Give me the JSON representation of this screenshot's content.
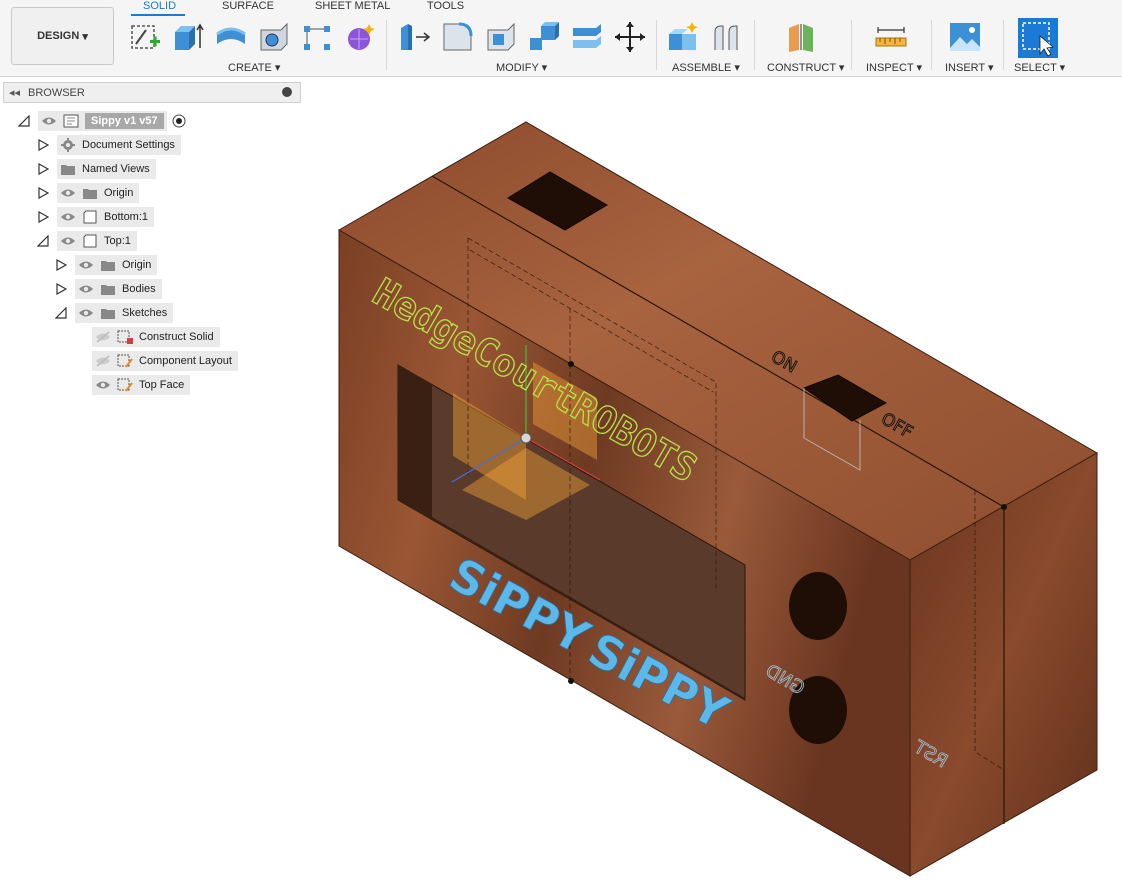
{
  "design_menu": {
    "label": "DESIGN"
  },
  "tabs": [
    {
      "label": "SOLID"
    },
    {
      "label": "SURFACE"
    },
    {
      "label": "SHEET METAL"
    },
    {
      "label": "TOOLS"
    }
  ],
  "groups": {
    "create": "CREATE",
    "modify": "MODIFY",
    "assemble": "ASSEMBLE",
    "construct": "CONSTRUCT",
    "inspect": "INSPECT",
    "insert": "INSERT",
    "select": "SELECT"
  },
  "browser": {
    "title": "BROWSER",
    "root": "Sippy v1 v57",
    "items": [
      {
        "label": "Document Settings"
      },
      {
        "label": "Named Views"
      },
      {
        "label": "Origin"
      },
      {
        "label": "Bottom:1"
      },
      {
        "label": "Top:1"
      },
      {
        "label": "Origin"
      },
      {
        "label": "Bodies"
      },
      {
        "label": "Sketches"
      },
      {
        "label": "Construct Solid"
      },
      {
        "label": "Component Layout"
      },
      {
        "label": "Top Face"
      }
    ]
  },
  "model_text": {
    "brand": "HedgeCourtROBOTS",
    "sippy": "SiPPY",
    "on": "ON",
    "off": "OFF",
    "gnd": "GND",
    "rst": "RST"
  },
  "colors": {
    "accent": "#1a7ad6",
    "wood": "#8a4a2c",
    "sippy_text": "#5bb8e8",
    "brand_text": "#b7e04a"
  }
}
